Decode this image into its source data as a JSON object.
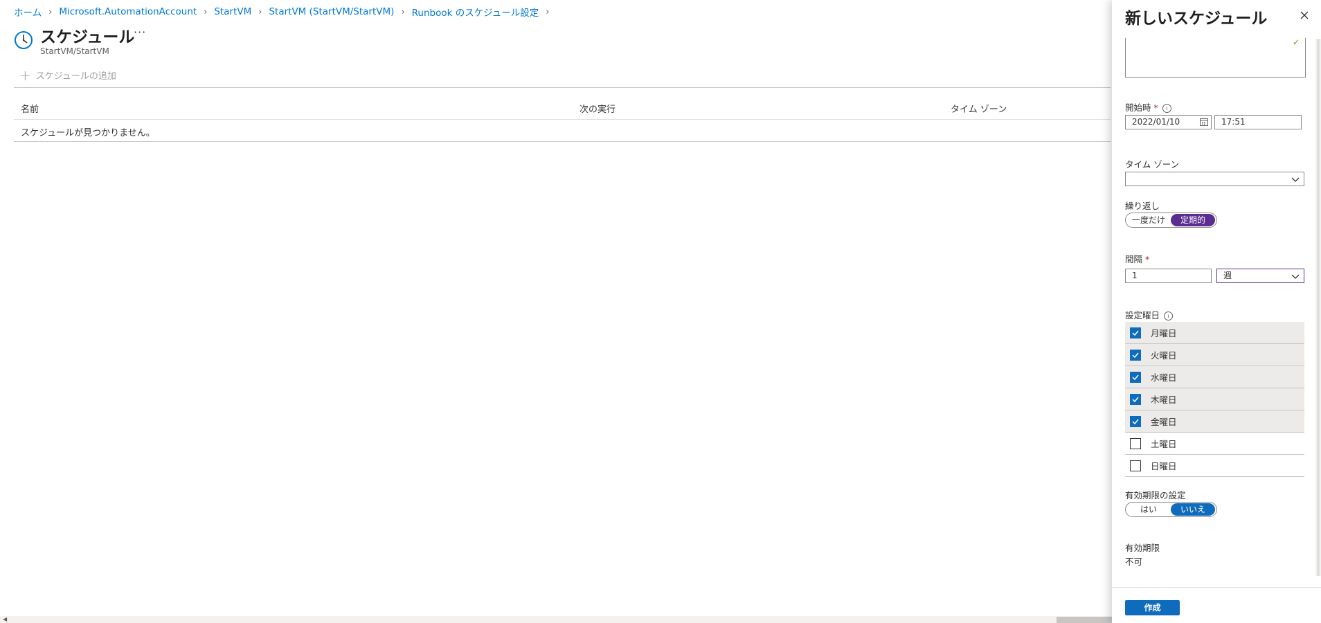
{
  "breadcrumb": [
    {
      "label": "ホーム"
    },
    {
      "label": "Microsoft.AutomationAccount"
    },
    {
      "label": "StartVM"
    },
    {
      "label": "StartVM (StartVM/StartVM)"
    },
    {
      "label": "Runbook のスケジュール設定"
    }
  ],
  "page": {
    "title": "スケジュール",
    "more": "···",
    "subtitle": "StartVM/StartVM"
  },
  "toolbar": {
    "add_label": "スケジュールの追加"
  },
  "grid": {
    "columns": [
      "名前",
      "次の実行",
      "タイム ゾーン"
    ],
    "empty_message": "スケジュールが見つかりません。"
  },
  "panel": {
    "title": "新しいスケジュール",
    "start_label": "開始時",
    "required_mark": "*",
    "start_date": "2022/01/10",
    "start_time": "17:51",
    "timezone_label": "タイム ゾーン",
    "timezone_value": "",
    "repeat_label": "繰り返し",
    "repeat_options": [
      "一度だけ",
      "定期的"
    ],
    "repeat_selected": "定期的",
    "interval_label": "間隔",
    "interval_value": "1",
    "interval_unit": "週",
    "weekdays_label": "設定曜日",
    "days": [
      {
        "label": "月曜日",
        "checked": true
      },
      {
        "label": "火曜日",
        "checked": true
      },
      {
        "label": "水曜日",
        "checked": true
      },
      {
        "label": "木曜日",
        "checked": true
      },
      {
        "label": "金曜日",
        "checked": true
      },
      {
        "label": "土曜日",
        "checked": false
      },
      {
        "label": "日曜日",
        "checked": false
      }
    ],
    "expiry_setting_label": "有効期限の設定",
    "expiry_options": [
      "はい",
      "いいえ"
    ],
    "expiry_selected": "いいえ",
    "expiry_label": "有効期限",
    "expiry_value": "不可",
    "create_label": "作成"
  },
  "colors": {
    "link": "#0078d4",
    "primary": "#0f6cbd",
    "purple_accent": "#5c2d91",
    "required": "#a4262c"
  }
}
